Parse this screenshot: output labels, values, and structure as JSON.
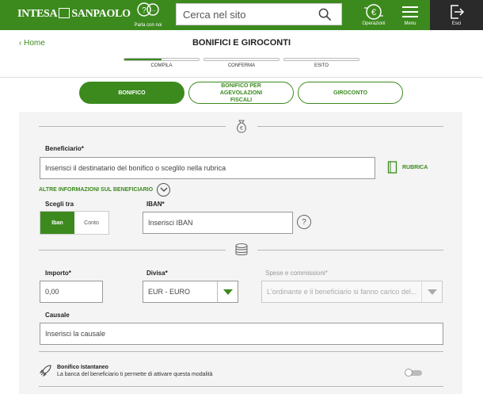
{
  "header": {
    "brand_left": "INTESA",
    "brand_right": "SANPAOLO",
    "talk_label": "Parla con noi",
    "search_placeholder": "Cerca nel sito",
    "operazioni_label": "Operazioni",
    "menu_label": "Menu",
    "exit_label": "Esci",
    "accent": "#3c8a1e",
    "dark": "#2a2a2a"
  },
  "subheader": {
    "home_label": "Home",
    "title": "BONIFICI E GIROCONTI",
    "steps": [
      {
        "label": "COMPILA",
        "progress": 0.5
      },
      {
        "label": "CONFERMA",
        "progress": 0
      },
      {
        "label": "ESITO",
        "progress": 0
      }
    ]
  },
  "tabs": [
    {
      "label": "BONIFICO",
      "active": true
    },
    {
      "label": "BONIFICO PER AGEVOLAZIONI FISCALI",
      "active": false
    },
    {
      "label": "GIROCONTO",
      "active": false
    }
  ],
  "form": {
    "beneficiario_label": "Beneficiario*",
    "beneficiario_placeholder": "Inserisci il destinatario del bonifico o sceglilo nella rubrica",
    "rubrica_label": "RUBRICA",
    "altre_info_label": "ALTRE INFORMAZIONI SUL BENEFICIARIO",
    "scegli_label": "Scegli tra",
    "scegli_options": [
      "Iban",
      "Conto"
    ],
    "iban_label": "IBAN*",
    "iban_placeholder": "Inserisci IBAN",
    "help_symbol": "?",
    "importo_label": "Importo*",
    "importo_value": "0,00",
    "divisa_label": "Divisa*",
    "divisa_value": "EUR - EURO",
    "spese_label": "Spese e commissioni*",
    "spese_value": "L'ordinante e il beneficiario si fanno carico del...",
    "causale_label": "Causale",
    "causale_placeholder": "Inserisci la causale",
    "istantaneo_title": "Bonifico Istantaneo",
    "istantaneo_sub": "La banca del beneficiario ti permette di attivare questa modalità"
  }
}
